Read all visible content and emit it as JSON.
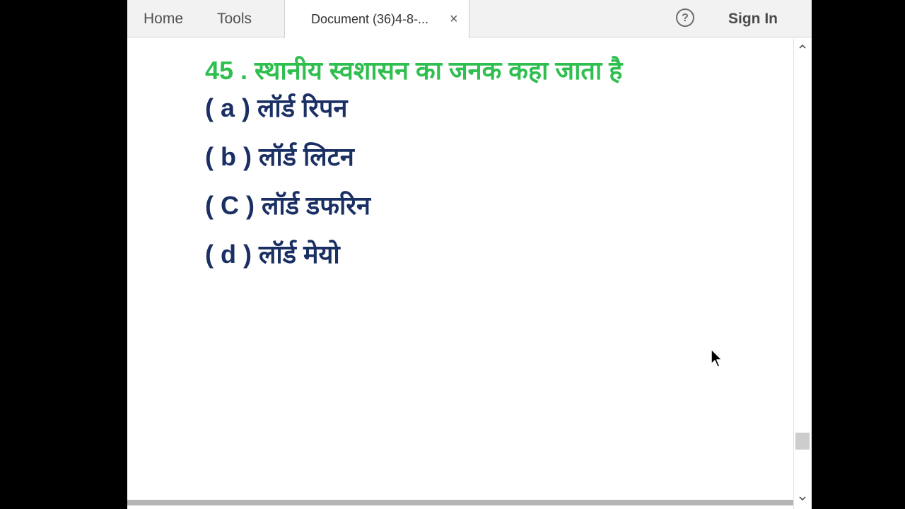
{
  "nav": {
    "home": "Home",
    "tools": "Tools",
    "document_tab": "Document (36)4-8-...",
    "close": "×",
    "help": "?",
    "sign_in": "Sign In"
  },
  "document": {
    "question": "45 . स्थानीय स्वशासन का जनक कहा जाता है",
    "options": [
      "( a ) लॉर्ड रिपन",
      "( b ) लॉर्ड लिटन",
      "( C ) लॉर्ड डफरिन",
      "( d ) लॉर्ड मेयो"
    ]
  },
  "icons": {
    "help": "help-circle-icon",
    "close": "close-icon",
    "scroll_up": "chevron-up-icon",
    "scroll_down": "chevron-down-icon",
    "cursor": "mouse-pointer-icon"
  },
  "colors": {
    "question": "#2fbf4f",
    "option": "#1a2f63",
    "chrome": "#f2f2f2",
    "outside": "#000000"
  }
}
